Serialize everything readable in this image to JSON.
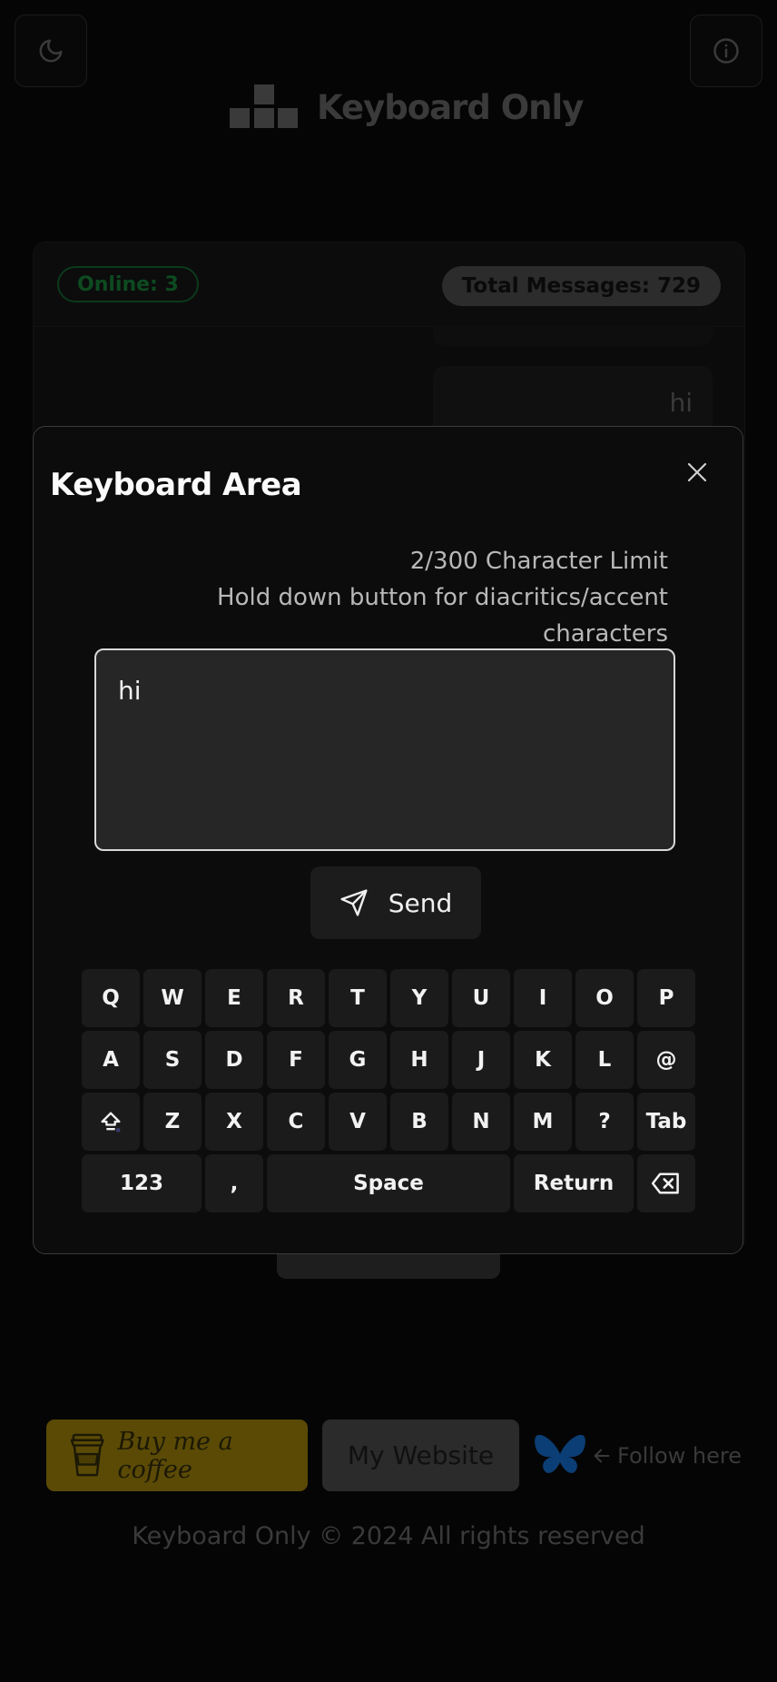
{
  "app": {
    "brand_name": "Keyboard Only"
  },
  "header": {
    "theme_icon": "moon-icon",
    "info_icon": "info-icon"
  },
  "chat": {
    "online_label": "Online: 3",
    "total_messages_label": "Total Messages: 729",
    "last_message": "hi"
  },
  "modal": {
    "title": "Keyboard Area",
    "char_limit": "2/300 Character Limit",
    "hint_line1": "Hold down button for diacritics/accent",
    "hint_line2": "characters",
    "input_value": "hi",
    "send_label": "Send"
  },
  "keyboard": {
    "row1": [
      "Q",
      "W",
      "E",
      "R",
      "T",
      "Y",
      "U",
      "I",
      "O",
      "P"
    ],
    "row2": [
      "A",
      "S",
      "D",
      "F",
      "G",
      "H",
      "J",
      "K",
      "L",
      "@"
    ],
    "row3": [
      "Z",
      "X",
      "C",
      "V",
      "B",
      "N",
      "M",
      "?",
      "Tab"
    ],
    "row4": [
      "123",
      ",",
      "Space",
      "Return"
    ]
  },
  "footer": {
    "coffee_label": "Buy me a coffee",
    "website_label": "My Website",
    "follow_label": "Follow here",
    "copyright": "Keyboard Only © 2024 All rights reserved"
  },
  "colors": {
    "background": "#050505",
    "accent_online": "#0d4a20",
    "coffee_yellow": "#5a4a05",
    "bluesky_blue": "#0b3e75"
  }
}
